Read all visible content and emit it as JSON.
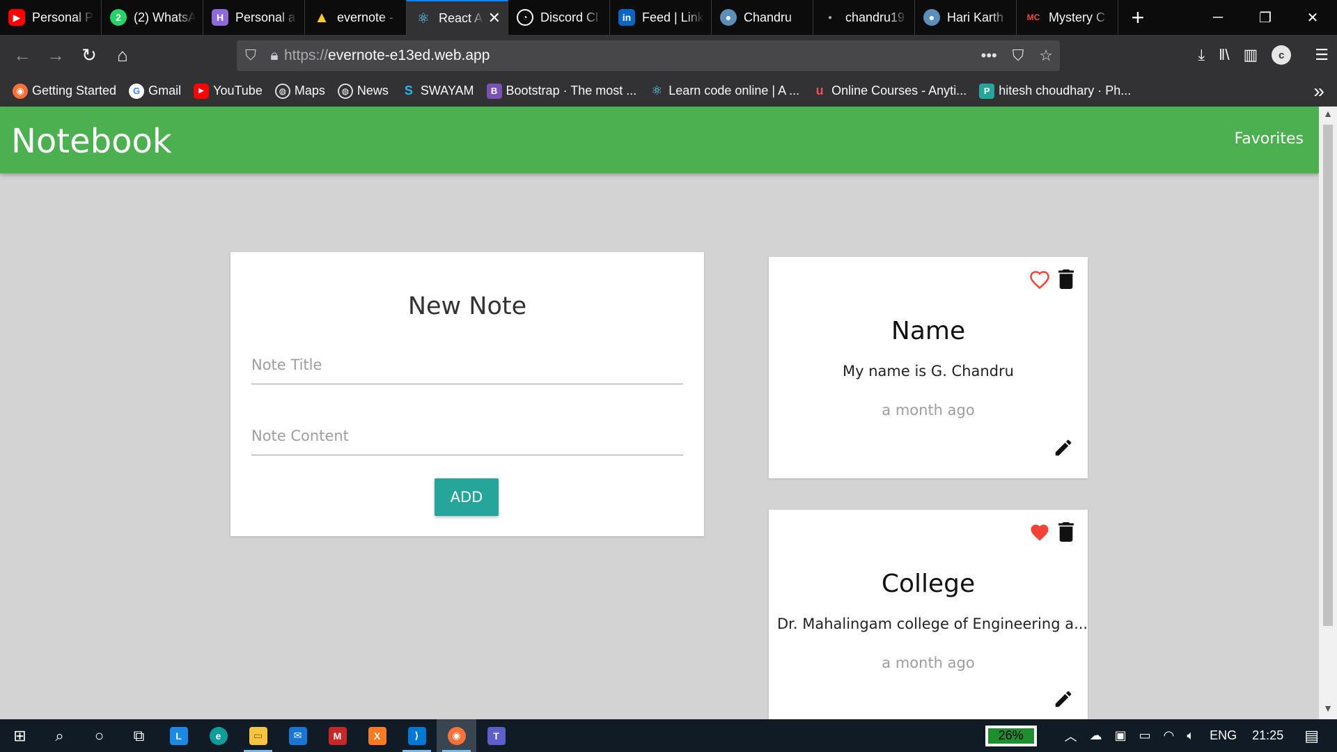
{
  "browser": {
    "tabs": [
      {
        "label": "Personal P",
        "icon": "youtube-icon",
        "color": "#ff0000"
      },
      {
        "label": "(2) WhatsA",
        "icon": "whatsapp-icon",
        "color": "#25d366"
      },
      {
        "label": "Personal a",
        "icon": "hashnode-icon",
        "color": "#8e6ad8"
      },
      {
        "label": "evernote -",
        "icon": "firebase-icon",
        "color": "#ffca28"
      },
      {
        "label": "React A",
        "icon": "react-icon",
        "color": "#61dafb"
      },
      {
        "label": "Discord Cl",
        "icon": "discord-icon",
        "color": "#7289da"
      },
      {
        "label": "Feed | Link",
        "icon": "linkedin-icon",
        "color": "#0a66c2"
      },
      {
        "label": "Chandru",
        "icon": "avatar-icon",
        "color": "#5b8fb9"
      },
      {
        "label": "chandru19",
        "icon": "dot-icon",
        "color": "#888888"
      },
      {
        "label": "Hari Karth",
        "icon": "avatar-icon",
        "color": "#5b8fb9"
      },
      {
        "label": "Mystery C",
        "icon": "mc-icon",
        "color": "#c0392b"
      }
    ],
    "active_tab_close": "✕",
    "new_tab": "+",
    "url_protocol": "https://",
    "url_host": "evernote-e13ed.web.app",
    "profile_initial": "c",
    "bookmarks": [
      {
        "label": "Getting Started",
        "icon": "firefox-icon",
        "color": "#ff7139"
      },
      {
        "label": "Gmail",
        "icon": "google-icon",
        "color": "#ffffff"
      },
      {
        "label": "YouTube",
        "icon": "youtube-icon",
        "color": "#ff0000"
      },
      {
        "label": "Maps",
        "icon": "globe-icon",
        "color": "#323234"
      },
      {
        "label": "News",
        "icon": "globe-icon",
        "color": "#323234"
      },
      {
        "label": "SWAYAM",
        "icon": "swayam-icon",
        "color": "#1e88e5"
      },
      {
        "label": "Bootstrap · The most ...",
        "icon": "bootstrap-icon",
        "color": "#7952b3"
      },
      {
        "label": "Learn code online | A ...",
        "icon": "react-icon",
        "color": "#323234"
      },
      {
        "label": "Online Courses - Anyti...",
        "icon": "udemy-icon",
        "color": "#323234"
      },
      {
        "label": "hitesh choudhary · Ph...",
        "icon": "page-icon",
        "color": "#26a69a"
      }
    ]
  },
  "app": {
    "brand": "Notebook",
    "nav_favorites": "Favorites",
    "form": {
      "title": "New Note",
      "title_placeholder": "Note Title",
      "content_placeholder": "Note Content",
      "add_label": "ADD"
    },
    "notes": [
      {
        "title": "Name",
        "content": "My name is G. Chandru",
        "time": "a month ago",
        "favorite": false
      },
      {
        "title": "College",
        "content": "Dr. Mahalingam college of Engineering a...",
        "time": "a month ago",
        "favorite": true
      }
    ],
    "accent_color": "#4caf50",
    "button_color": "#26a69a",
    "heart_color": "#f44336"
  },
  "taskbar": {
    "apps": [
      "windows-icon",
      "search-icon",
      "cortana-icon",
      "task-view-icon",
      "lens-icon",
      "edge-icon",
      "file-explorer-icon",
      "mail-icon",
      "mcafee-icon",
      "xampp-icon",
      "vscode-icon",
      "firefox-icon",
      "teams-icon"
    ],
    "battery_percent": "26%",
    "language": "ENG",
    "time": "21:25"
  }
}
